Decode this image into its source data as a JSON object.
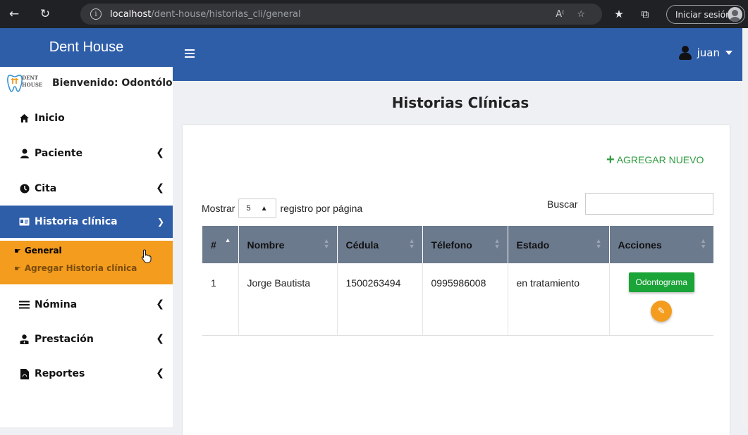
{
  "browser": {
    "url_host": "localhost",
    "url_path": "/dent-house/historias_cli/general",
    "signin_label": "Iniciar sesión"
  },
  "navbar": {
    "brand": "Dent House",
    "user_name": "juan"
  },
  "sidebar": {
    "welcome": "Bienvenido: Odontólogo",
    "items": [
      {
        "label": "Inicio",
        "icon": "home-icon"
      },
      {
        "label": "Paciente",
        "icon": "user-icon"
      },
      {
        "label": "Cita",
        "icon": "clock-icon"
      },
      {
        "label": "Historia clínica",
        "icon": "id-card-icon"
      },
      {
        "label": "Nómina",
        "icon": "list-icon"
      },
      {
        "label": "Prestación",
        "icon": "user-tie-icon"
      },
      {
        "label": "Reportes",
        "icon": "file-pdf-icon"
      }
    ],
    "submenu": [
      {
        "label": "General"
      },
      {
        "label": "Agregar Historia clínica"
      }
    ]
  },
  "page": {
    "title": "Historias Clínicas",
    "add_new": "AGREGAR NUEVO",
    "length_prefix": "Mostrar",
    "length_value": "5",
    "length_suffix": "registro por página",
    "search_label": "Buscar",
    "search_value": ""
  },
  "table": {
    "headers": [
      "#",
      "Nombre",
      "Cédula",
      "Télefono",
      "Estado",
      "Acciones"
    ],
    "rows": [
      {
        "num": "1",
        "nombre": "Jorge Bautista",
        "cedula": "1500263494",
        "telefono": "0995986008",
        "estado": "en tratamiento",
        "action_label": "Odontograma"
      }
    ]
  },
  "colors": {
    "navbar": "#2f5ea9",
    "submenu": "#f39c1e",
    "table_header": "#6c7a8e",
    "add_new": "#2e9a3e",
    "btn_odonto": "#1ba438"
  }
}
